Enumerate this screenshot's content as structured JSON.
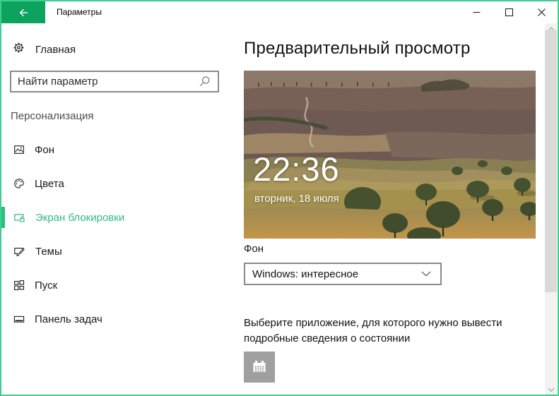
{
  "titlebar": {
    "title": "Параметры"
  },
  "sidebar": {
    "home_label": "Главная",
    "home_icon": "gear-icon",
    "search_placeholder": "Найти параметр",
    "search_icon": "magnifier-icon",
    "section_label": "Персонализация",
    "items": [
      {
        "label": "Фон",
        "icon": "image-icon",
        "selected": false
      },
      {
        "label": "Цвета",
        "icon": "palette-icon",
        "selected": false
      },
      {
        "label": "Экран блокировки",
        "icon": "monitor-lock-icon",
        "selected": true
      },
      {
        "label": "Темы",
        "icon": "monitor-pen-icon",
        "selected": false
      },
      {
        "label": "Пуск",
        "icon": "tiles-icon",
        "selected": false
      },
      {
        "label": "Панель задач",
        "icon": "taskbar-icon",
        "selected": false
      }
    ]
  },
  "main": {
    "heading": "Предварительный просмотр",
    "preview": {
      "time": "22:36",
      "date": "вторник, 18 июля"
    },
    "background_label": "Фон",
    "background_value": "Windows: интересное",
    "status_prompt": "Выберите приложение, для которого нужно вывести подробные сведения о состоянии",
    "status_app_icon": "calendar-icon"
  },
  "window_controls": {
    "minimize": "minimize-icon",
    "maximize": "maximize-icon",
    "close": "close-icon",
    "back": "back-arrow-icon"
  },
  "colors": {
    "window_border": "#3FCE90",
    "accent_button": "#0CA35F",
    "selected_green": "#2EBD81",
    "border_gray": "#8A8A8A",
    "button_gray": "#A0A0A0",
    "scrollbar_track": "#F2F2F2",
    "scrollbar_thumb": "#DADADA"
  }
}
